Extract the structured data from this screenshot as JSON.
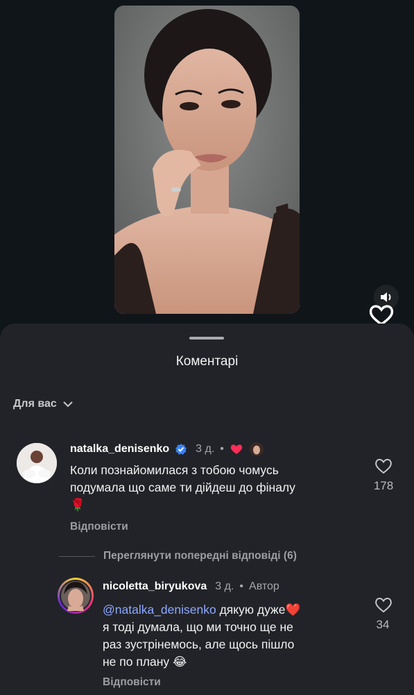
{
  "sheet": {
    "title": "Коментарі",
    "filter_label": "Для вас"
  },
  "comment1": {
    "username": "natalka_denisenko",
    "time": "3 д.",
    "text_line1": "Коли познайомилася з тобою чомусь",
    "text_line2": "подумала що саме ти дійдеш до фіналу",
    "emoji": "🌹",
    "reply_label": "Відповісти",
    "likes": "178"
  },
  "thread": {
    "view_previous": "Переглянути попередні відповіді (6)"
  },
  "comment2": {
    "username": "nicoletta_biryukova",
    "time": "3 д.",
    "author_label": "Автор",
    "mention": "@natalka_denisenko",
    "text_line1_rest": " дякую дуже❤️",
    "text_line2": "я тоді думала, що ми точно ще не",
    "text_line3": "раз зустрінемось, але щось пішло",
    "text_line4": "не по плану 😂",
    "reply_label": "Відповісти",
    "likes": "34"
  },
  "colors": {
    "background": "#0f1316",
    "sheet": "#212328",
    "mention": "#8ea8ff",
    "verified": "#3b82f6",
    "like_red": "#ff2d55"
  }
}
